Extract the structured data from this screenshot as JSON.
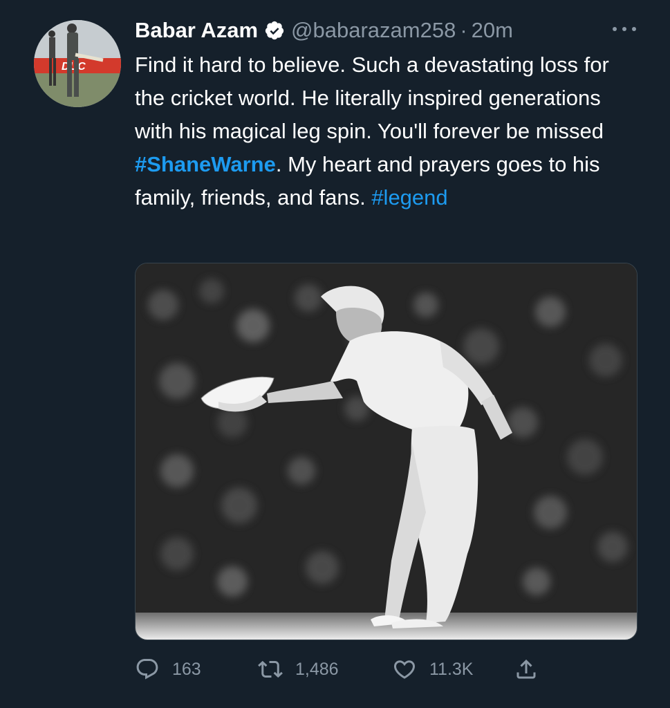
{
  "author": {
    "name": "Babar Azam",
    "verified": true,
    "handle": "@babarazam258",
    "separator": "·",
    "time": "20m"
  },
  "tweet": {
    "segments": [
      {
        "text": "Find it hard to believe. Such a devastating loss for the cricket world. He literally inspired generations with his magical leg spin. You'll forever be missed ",
        "kind": "plain"
      },
      {
        "text": "#ShaneWarne",
        "kind": "hashtag-bold"
      },
      {
        "text": ". My heart and prayers goes to his family, friends, and fans. ",
        "kind": "plain"
      },
      {
        "text": "#legend",
        "kind": "hashtag"
      }
    ]
  },
  "actions": {
    "replies": "163",
    "retweets": "1,486",
    "likes": "11.3K"
  },
  "icons": {
    "verified": "verified-badge-icon",
    "more": "more-icon",
    "reply": "reply-icon",
    "retweet": "retweet-icon",
    "like": "heart-icon",
    "share": "share-icon"
  },
  "colors": {
    "background": "#15202b",
    "text": "#ffffff",
    "secondary": "#8b98a5",
    "link": "#1d9bf0"
  }
}
